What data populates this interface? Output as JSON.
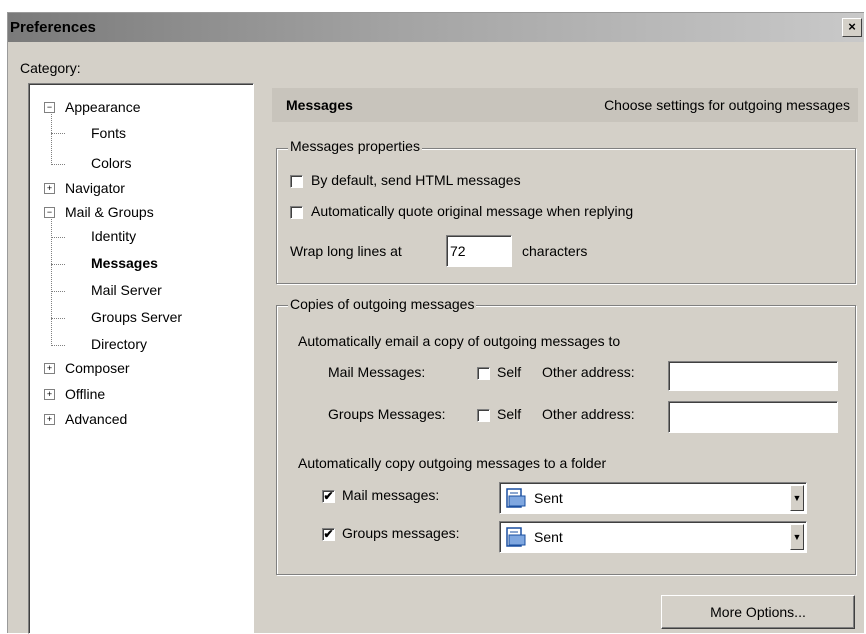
{
  "window": {
    "title": "Preferences",
    "close_glyph": "×"
  },
  "category": {
    "label": "Category:"
  },
  "tree": {
    "items": [
      {
        "label": "Appearance",
        "expander": "−"
      },
      {
        "label": "Fonts"
      },
      {
        "label": "Colors"
      },
      {
        "label": "Navigator",
        "expander": "+"
      },
      {
        "label": "Mail & Groups",
        "expander": "−"
      },
      {
        "label": "Identity"
      },
      {
        "label": "Messages"
      },
      {
        "label": "Mail Server"
      },
      {
        "label": "Groups Server"
      },
      {
        "label": "Directory"
      },
      {
        "label": "Composer",
        "expander": "+"
      },
      {
        "label": "Offline",
        "expander": "+"
      },
      {
        "label": "Advanced",
        "expander": "+"
      }
    ],
    "selected": "Messages"
  },
  "header": {
    "title": "Messages",
    "description": "Choose settings for outgoing messages"
  },
  "properties": {
    "legend": "Messages properties",
    "html_label": "By default, send HTML messages",
    "html_checked": false,
    "quote_label": "Automatically quote original message when replying",
    "quote_checked": false,
    "wrap_label": "Wrap long lines at",
    "wrap_value": "72",
    "wrap_suffix": "characters"
  },
  "copies": {
    "legend": "Copies of outgoing messages",
    "email_copy_label": "Automatically email a copy of outgoing messages to",
    "mail_messages_label": "Mail Messages:",
    "mail_self_label": "Self",
    "mail_self_checked": false,
    "mail_other_label": "Other address:",
    "mail_other_value": "",
    "groups_messages_label": "Groups Messages:",
    "groups_self_label": "Self",
    "groups_self_checked": false,
    "groups_other_label": "Other address:",
    "groups_other_value": "",
    "folder_copy_label": "Automatically copy outgoing messages to a folder",
    "mail_folder_label": "Mail messages:",
    "mail_folder_checked": true,
    "mail_folder_value": "Sent",
    "groups_folder_label": "Groups messages:",
    "groups_folder_checked": true,
    "groups_folder_value": "Sent",
    "check_glyph": "✔"
  },
  "more_options_label": "More Options...",
  "icons": {
    "folder": "folder-icon",
    "dropdown": "chevron-down-icon",
    "close": "close-icon"
  }
}
